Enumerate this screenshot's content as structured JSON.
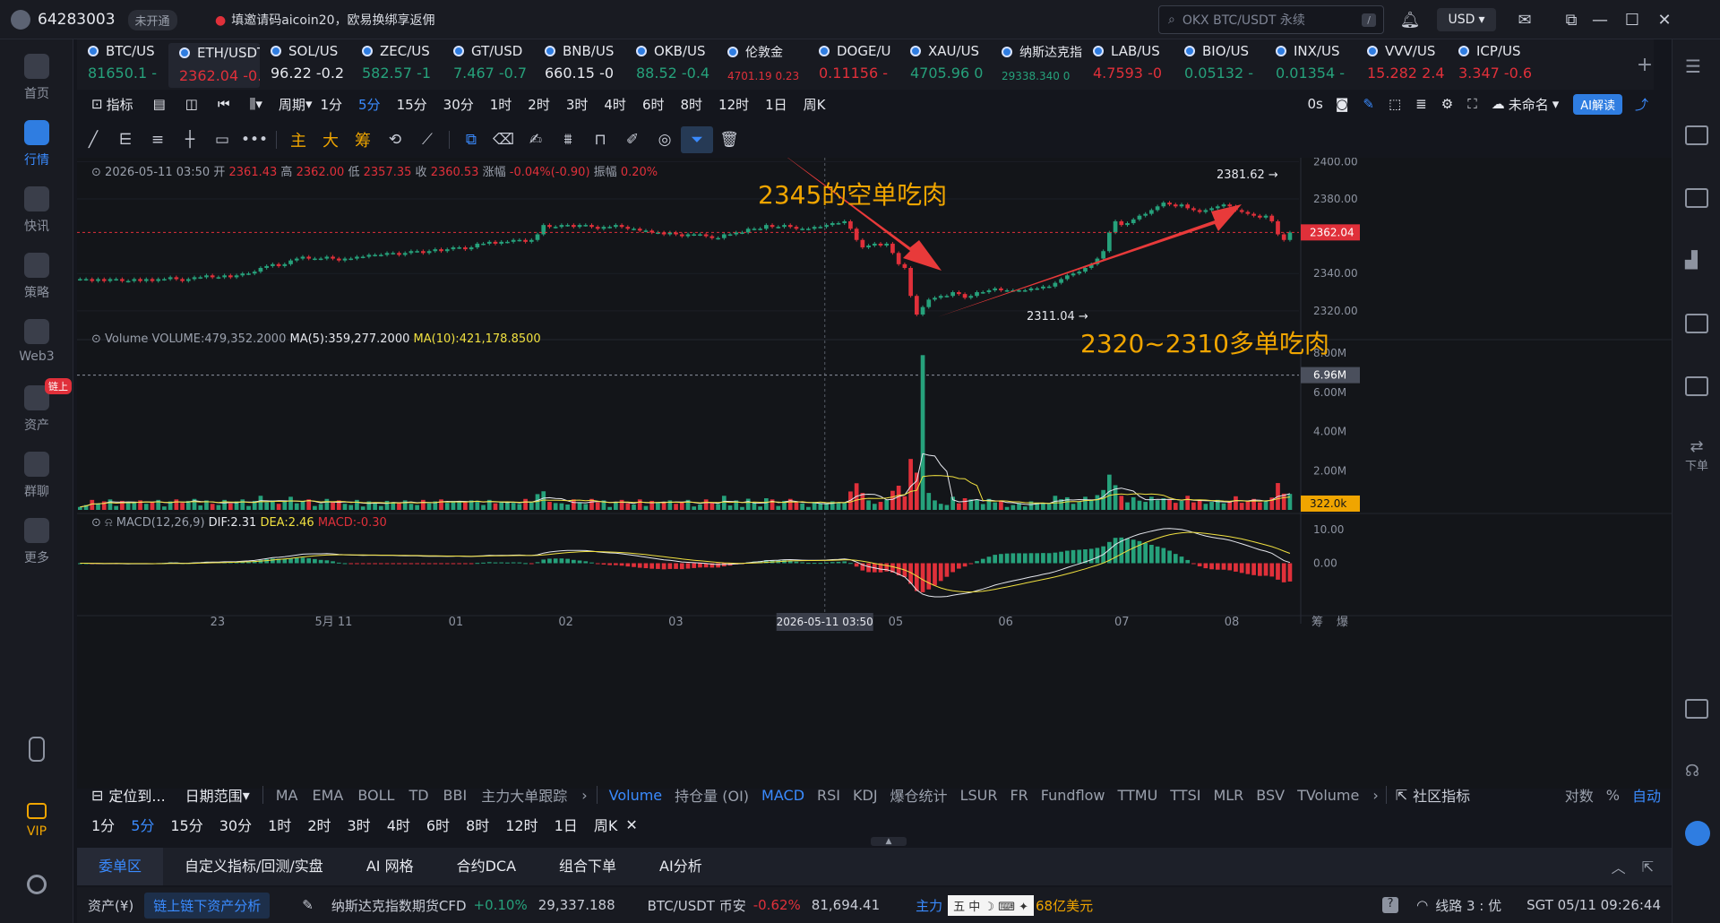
{
  "titlebar": {
    "user_id": "64283003",
    "status_pill": "未开通",
    "promo": "填邀请码aicoin20，欧易换绑享返佣",
    "search_placeholder": "OKX BTC/USDT 永续",
    "search_shortcut": "/",
    "currency": "USD"
  },
  "sidebar": {
    "items": [
      {
        "label": "首页"
      },
      {
        "label": "行情"
      },
      {
        "label": "快讯"
      },
      {
        "label": "策略"
      },
      {
        "label": "Web3"
      },
      {
        "label": "资产",
        "badge": "链上"
      },
      {
        "label": "群聊"
      },
      {
        "label": "更多"
      },
      {
        "label": "VIP"
      }
    ]
  },
  "rsidebar": {
    "order_label": "下单"
  },
  "symbols": [
    {
      "name": "BTC/US",
      "price": "81650.1 -",
      "dir": "up"
    },
    {
      "name": "ETH/USDT永续",
      "price": "2362.04  -0.32%",
      "dir": "dn"
    },
    {
      "name": "SOL/US",
      "price": "96.22 -0.2",
      "dir": "flat"
    },
    {
      "name": "ZEC/US",
      "price": "582.57 -1",
      "dir": "up"
    },
    {
      "name": "GT/USD",
      "price": "7.467 -0.7",
      "dir": "up"
    },
    {
      "name": "BNB/US",
      "price": "660.15 -0",
      "dir": "flat"
    },
    {
      "name": "OKB/US",
      "price": "88.52 -0.4",
      "dir": "up"
    },
    {
      "name": "伦敦金",
      "price": "4701.19 0.23",
      "dir": "dn"
    },
    {
      "name": "DOGE/U",
      "price": "0.11156 -",
      "dir": "dn"
    },
    {
      "name": "XAU/US",
      "price": "4705.96 0",
      "dir": "up"
    },
    {
      "name": "纳斯达克指数",
      "price": "29338.340 0",
      "dir": "up"
    },
    {
      "name": "LAB/US",
      "price": "4.7593 -0",
      "dir": "dn"
    },
    {
      "name": "BIO/US",
      "price": "0.05132 -",
      "dir": "up"
    },
    {
      "name": "INX/US",
      "price": "0.01354 -",
      "dir": "up"
    },
    {
      "name": "VVV/US",
      "price": "15.282 2.4",
      "dir": "dn"
    },
    {
      "name": "ICP/US",
      "price": "3.347 -0.6",
      "dir": "dn"
    }
  ],
  "toolbar1": {
    "indicators": "指标",
    "period": "周期",
    "intervals": [
      "1分",
      "5分",
      "15分",
      "30分",
      "1时",
      "2时",
      "3时",
      "4时",
      "6时",
      "8时",
      "12时",
      "1日",
      "周K"
    ],
    "active_interval": "5分",
    "countdown": "0s",
    "layout_name": "未命名",
    "ai_button": "AI解读"
  },
  "toolbar2": {
    "cn_tools": [
      "主",
      "大",
      "筹"
    ]
  },
  "chart_data": {
    "type": "candlestick",
    "ohlc_header": {
      "time": "2026-05-11 03:50",
      "open_label": "开",
      "open": "2361.43",
      "high_label": "高",
      "high": "2362.00",
      "low_label": "低",
      "low": "2357.35",
      "close_label": "收",
      "close": "2360.53",
      "change_label": "涨幅",
      "change": "-0.04%(-0.90)",
      "amp_label": "振幅",
      "amp": "0.20%"
    },
    "price_axis": {
      "ticks": [
        "2400.00",
        "2380.00",
        "2340.00",
        "2320.00"
      ],
      "ylim": [
        2306,
        2404
      ],
      "last_price": "2362.04"
    },
    "x_axis": {
      "ticks": [
        "23",
        "5月 11",
        "01",
        "02",
        "03",
        "05",
        "06",
        "07",
        "08"
      ],
      "crosshair_label": "2026-05-11 03:50"
    },
    "annotations": {
      "high_marker": "2381.62 →",
      "low_marker": "2311.04 →",
      "short_note": "2345的空单吃肉",
      "long_note": "2320~2310多单吃肉"
    },
    "price_path": [
      2337,
      2337,
      2336,
      2337,
      2336,
      2337,
      2337,
      2336,
      2336,
      2337,
      2336,
      2337,
      2336,
      2337,
      2337,
      2338,
      2337,
      2336,
      2337,
      2338,
      2338,
      2339,
      2338,
      2338,
      2339,
      2338,
      2339,
      2340,
      2340,
      2341,
      2343,
      2344,
      2345,
      2344,
      2345,
      2347,
      2348,
      2349,
      2348,
      2348,
      2348,
      2349,
      2348,
      2347,
      2348,
      2348,
      2349,
      2349,
      2350,
      2350,
      2350,
      2351,
      2351,
      2350,
      2351,
      2352,
      2352,
      2351,
      2352,
      2353,
      2352,
      2353,
      2354,
      2354,
      2353,
      2354,
      2356,
      2356,
      2357,
      2356,
      2357,
      2357,
      2358,
      2358,
      2357,
      2358,
      2361,
      2366,
      2365,
      2365,
      2366,
      2366,
      2365,
      2366,
      2366,
      2365,
      2364,
      2365,
      2365,
      2366,
      2365,
      2364,
      2364,
      2363,
      2363,
      2362,
      2362,
      2361,
      2362,
      2361,
      2360,
      2361,
      2361,
      2361,
      2360,
      2359,
      2359,
      2361,
      2361,
      2362,
      2362,
      2364,
      2364,
      2364,
      2366,
      2365,
      2365,
      2366,
      2365,
      2364,
      2364,
      2364,
      2365,
      2365,
      2366,
      2367,
      2367,
      2368,
      2364,
      2358,
      2354,
      2355,
      2356,
      2355,
      2356,
      2351,
      2345,
      2343,
      2328,
      2318,
      2322,
      2326,
      2327,
      2328,
      2328,
      2330,
      2329,
      2327,
      2328,
      2330,
      2330,
      2331,
      2332,
      2331,
      2331,
      2331,
      2331,
      2331,
      2332,
      2332,
      2333,
      2333,
      2335,
      2337,
      2339,
      2340,
      2341,
      2343,
      2345,
      2348,
      2352,
      2362,
      2368,
      2366,
      2367,
      2369,
      2371,
      2372,
      2374,
      2376,
      2378,
      2377,
      2376,
      2377,
      2375,
      2374,
      2373,
      2374,
      2375,
      2376,
      2377,
      2376,
      2374,
      2373,
      2372,
      2371,
      2370,
      2371,
      2368,
      2361,
      2358,
      2362
    ],
    "volume": {
      "label": "Volume",
      "text": "VOLUME:479,352.2000",
      "ma5_text": "MA(5):359,277.2000",
      "ma10_text": "MA(10):421,178.8500",
      "ticks": [
        "8.00M",
        "6.00M",
        "4.00M",
        "2.00M"
      ],
      "crosshair_value": "6.96M",
      "last_value": "322.0k"
    },
    "macd": {
      "label": "MACD(12,26,9)",
      "dif_text": "DIF:2.31",
      "dea_text": "DEA:2.46",
      "macd_text": "MACD:-0.30",
      "ticks": [
        "10.00",
        "0.00"
      ]
    }
  },
  "indicator_bar": {
    "locate": "定位到...",
    "date_range": "日期范围",
    "main_inds": [
      "MA",
      "EMA",
      "BOLL",
      "TD",
      "BBI",
      "主力大单跟踪"
    ],
    "sub_inds": [
      "Volume",
      "持仓量 (OI)",
      "MACD",
      "RSI",
      "KDJ",
      "爆仓统计",
      "LSUR",
      "FR",
      "Fundflow",
      "TTMU",
      "TTSI",
      "MLR",
      "BSV",
      "TVolume"
    ],
    "community": "社区指标",
    "right_opts": [
      "对数",
      "%",
      "自动"
    ],
    "corner_labels": [
      "筹",
      "爆"
    ]
  },
  "period_bar": [
    "1分",
    "5分",
    "15分",
    "30分",
    "1时",
    "2时",
    "3时",
    "4时",
    "6时",
    "8时",
    "12时",
    "1日",
    "周K"
  ],
  "bottom_tabs": [
    "委单区",
    "自定义指标/回测/实盘",
    "AI 网格",
    "合约DCA",
    "组合下单",
    "AI分析"
  ],
  "status_bar": {
    "assets": "资产(¥)",
    "asset_analysis": "链上链下资产分析",
    "nasdaq_name": "纳斯达克指数期货CFD",
    "nasdaq_change": "+0.10%",
    "nasdaq_value": "29,337.188",
    "btc_name": "BTC/USDT 币安",
    "btc_change": "-0.62%",
    "btc_value": "81,694.41",
    "ticker_text": "主力",
    "ticker_tail": "68亿美元",
    "line": "线路 3 : 优",
    "time": "SGT 05/11 09:26:44"
  },
  "colors": {
    "up": "#26a17b",
    "down": "#e0303a",
    "accent": "#3a8bff",
    "note": "#f0a500"
  }
}
